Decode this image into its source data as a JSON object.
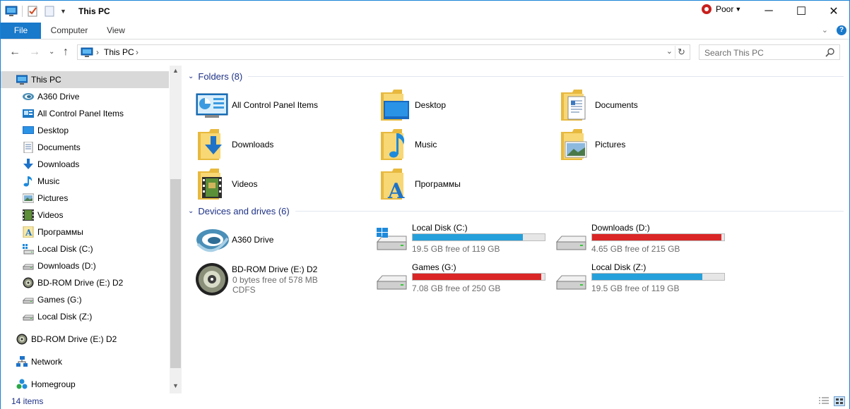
{
  "window": {
    "title": "This PC",
    "connection_quality": "Poor",
    "controls": {
      "minimize": "─",
      "maximize": "☐",
      "close": "✕"
    }
  },
  "ribbon": {
    "tabs": [
      {
        "label": "File",
        "active": true
      },
      {
        "label": "Computer",
        "active": false
      },
      {
        "label": "View",
        "active": false
      }
    ]
  },
  "address": {
    "breadcrumbs": [
      "This PC"
    ],
    "search_placeholder": "Search This PC"
  },
  "sidebar": {
    "items": [
      {
        "label": "This PC",
        "icon": "this-pc-icon",
        "selected": true
      },
      {
        "label": "A360 Drive",
        "icon": "a360-drive-icon"
      },
      {
        "label": "All Control Panel Items",
        "icon": "control-panel-icon"
      },
      {
        "label": "Desktop",
        "icon": "desktop-icon"
      },
      {
        "label": "Documents",
        "icon": "documents-icon"
      },
      {
        "label": "Downloads",
        "icon": "downloads-icon"
      },
      {
        "label": "Music",
        "icon": "music-icon"
      },
      {
        "label": "Pictures",
        "icon": "pictures-icon"
      },
      {
        "label": "Videos",
        "icon": "videos-icon"
      },
      {
        "label": "Программы",
        "icon": "programs-icon"
      },
      {
        "label": "Local Disk (C:)",
        "icon": "windows-drive-icon"
      },
      {
        "label": "Downloads (D:)",
        "icon": "drive-icon"
      },
      {
        "label": "BD-ROM Drive (E:) D2",
        "icon": "disc-drive-icon"
      },
      {
        "label": "Games (G:)",
        "icon": "drive-icon"
      },
      {
        "label": "Local Disk (Z:)",
        "icon": "drive-icon"
      },
      {
        "label": "BD-ROM Drive (E:) D2",
        "icon": "disc-drive-icon"
      },
      {
        "label": "Network",
        "icon": "network-icon"
      },
      {
        "label": "Homegroup",
        "icon": "homegroup-icon"
      }
    ]
  },
  "folders_group": {
    "header": "Folders (8)",
    "items": [
      {
        "label": "All Control Panel Items",
        "icon": "control-panel-icon"
      },
      {
        "label": "Desktop",
        "icon": "desktop-folder-icon"
      },
      {
        "label": "Documents",
        "icon": "documents-folder-icon"
      },
      {
        "label": "Downloads",
        "icon": "downloads-folder-icon"
      },
      {
        "label": "Music",
        "icon": "music-folder-icon"
      },
      {
        "label": "Pictures",
        "icon": "pictures-folder-icon"
      },
      {
        "label": "Videos",
        "icon": "videos-folder-icon"
      },
      {
        "label": "Программы",
        "icon": "programs-folder-icon"
      }
    ]
  },
  "drives_group": {
    "header": "Devices and drives (6)",
    "a360": {
      "label": "A360 Drive",
      "icon": "a360-drive-icon"
    },
    "bdrom": {
      "label": "BD-ROM Drive (E:) D2",
      "free": "0 bytes free of 578 MB",
      "fs": "CDFS",
      "icon": "disc-drive-icon"
    },
    "drives": [
      {
        "label": "Local Disk (C:)",
        "free": "19.5 GB free of 119 GB",
        "used_fraction": 0.836,
        "bar_color": "#26a0da",
        "icon": "windows-drive-icon"
      },
      {
        "label": "Downloads (D:)",
        "free": "4.65 GB free of 215 GB",
        "used_fraction": 0.978,
        "bar_color": "#da2626",
        "icon": "drive-icon"
      },
      {
        "label": "Games (G:)",
        "free": "7.08 GB free of 250 GB",
        "used_fraction": 0.972,
        "bar_color": "#da2626",
        "icon": "drive-icon"
      },
      {
        "label": "Local Disk (Z:)",
        "free": "19.5 GB free of 119 GB",
        "used_fraction": 0.836,
        "bar_color": "#26a0da",
        "icon": "drive-icon"
      }
    ]
  },
  "status": {
    "item_count": "14 items"
  }
}
